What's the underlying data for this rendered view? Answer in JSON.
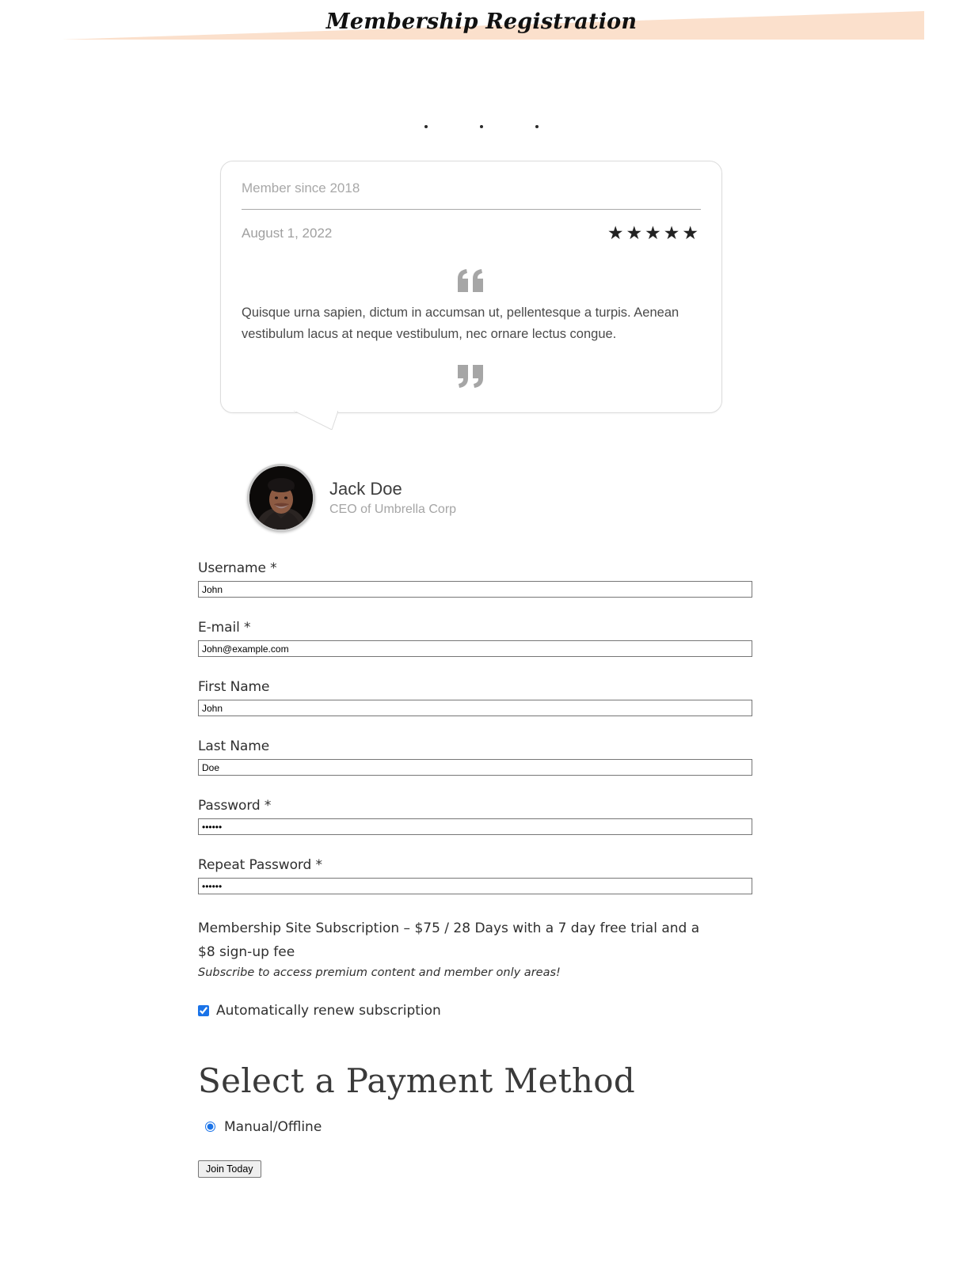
{
  "header": {
    "title": "Membership Registration",
    "banner_color": "#FBE0CC"
  },
  "slider": {
    "dots": [
      "dot-1",
      "dot-2",
      "dot-3"
    ],
    "active_index": 0
  },
  "testimonial": {
    "member_since": "Member since 2018",
    "date": "August 1, 2022",
    "rating": 5,
    "stars": "★★★★★",
    "quote_open": "“",
    "quote_close": "”",
    "quote": "Quisque urna sapien, dictum in accumsan ut, pellentesque a turpis. Aenean vestibulum lacus at neque vestibulum, nec ornare lectus congue.",
    "author_name": "Jack Doe",
    "author_role": "CEO of Umbrella Corp"
  },
  "form": {
    "fields": [
      {
        "label": "Username *",
        "value": "John",
        "name": "username"
      },
      {
        "label": "E-mail *",
        "value": "John@example.com",
        "name": "email"
      },
      {
        "label": "First Name",
        "value": "John",
        "name": "first-name"
      },
      {
        "label": "Last Name",
        "value": "Doe",
        "name": "last-name"
      },
      {
        "label": "Password *",
        "value": "••••••",
        "name": "password"
      },
      {
        "label": "Repeat Password *",
        "value": "••••••",
        "name": "repeat-password"
      }
    ],
    "subscription_description": "Membership Site Subscription – $75 / 28 Days with a 7 day free trial and a $8 sign-up fee",
    "subscription_note": "Subscribe to access premium content and member only areas!",
    "auto_renew_label": "Automatically renew subscription",
    "auto_renew_checked": true
  },
  "payment": {
    "heading": "Select a Payment Method",
    "options": [
      {
        "label": "Manual/Offline",
        "selected": true
      }
    ]
  },
  "submit": {
    "label": "Join Today"
  },
  "colors": {
    "accent": "#1a73e8",
    "banner": "#FBE0CC",
    "text": "#2f2f2f",
    "muted": "#a5a5a5"
  }
}
